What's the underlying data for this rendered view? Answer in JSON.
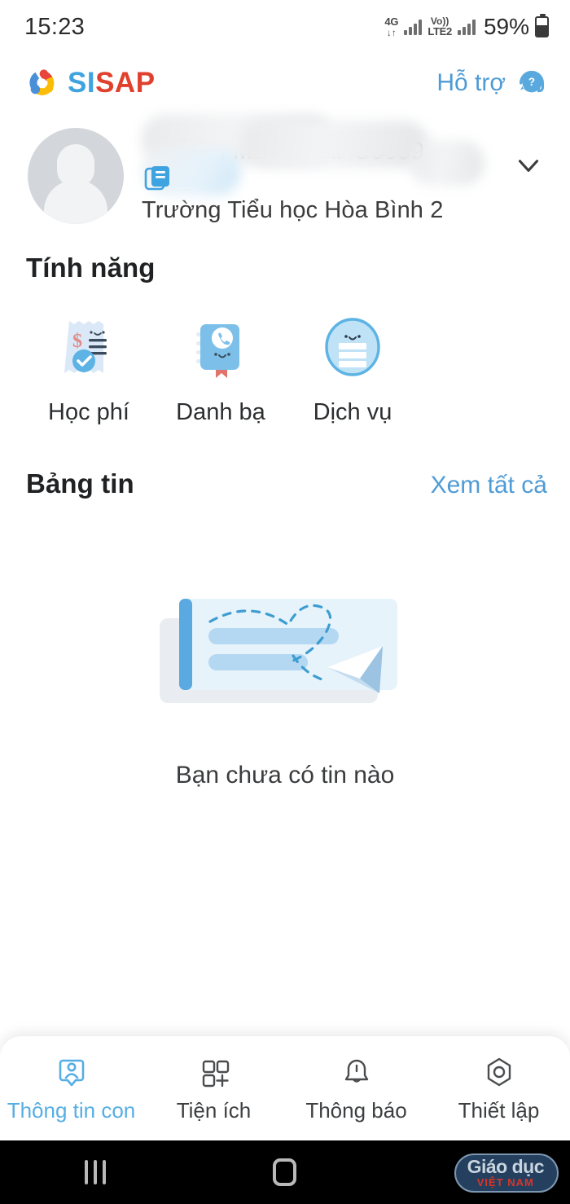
{
  "status_bar": {
    "time": "15:23",
    "network_type": "4G",
    "data_arrows": "↓↑",
    "volte_top": "Vo))",
    "volte_bottom": "LTE2",
    "battery_percent": "59%"
  },
  "app_header": {
    "brand_first": "SI",
    "brand_second": "SAP",
    "support_label": "Hỗ trợ",
    "support_icon": "headset-question-icon"
  },
  "profile": {
    "student_code_prefix": "| Mã HS:",
    "student_code": "HPG0099",
    "school_name": "Trường Tiểu học Hòa Bình 2",
    "school_icon": "book-document-icon",
    "expand_icon": "chevron-down-icon",
    "avatar_icon": "default-person-avatar"
  },
  "features": {
    "title": "Tính năng",
    "items": [
      {
        "label": "Học phí",
        "icon": "receipt-dollar-check-icon"
      },
      {
        "label": "Danh bạ",
        "icon": "phonebook-icon"
      },
      {
        "label": "Dịch vụ",
        "icon": "service-list-circle-icon"
      }
    ]
  },
  "news": {
    "title": "Bảng tin",
    "see_all_label": "Xem tất cả",
    "empty_text": "Bạn chưa có tin nào",
    "empty_illustration": "empty-message-envelope-illustration"
  },
  "bottom_nav": {
    "items": [
      {
        "label": "Thông tin con",
        "icon": "person-badge-icon",
        "active": true
      },
      {
        "label": "Tiện ích",
        "icon": "grid-plus-icon",
        "active": false
      },
      {
        "label": "Thông báo",
        "icon": "bell-icon",
        "active": false
      },
      {
        "label": "Thiết lập",
        "icon": "hexagon-gear-icon",
        "active": false
      }
    ]
  },
  "android_nav": {
    "recents_icon": "recents-icon",
    "home_icon": "home-icon",
    "back_icon": "back-chevron-icon"
  },
  "watermark": {
    "top_text": "Giáo dục",
    "bottom_text": "VIỆT NAM"
  },
  "colors": {
    "accent_blue": "#4e9bd6",
    "brand_blue": "#3fa3e0",
    "brand_red": "#e0402e",
    "nav_active": "#55aee4",
    "text_dark": "#2c2e30"
  }
}
